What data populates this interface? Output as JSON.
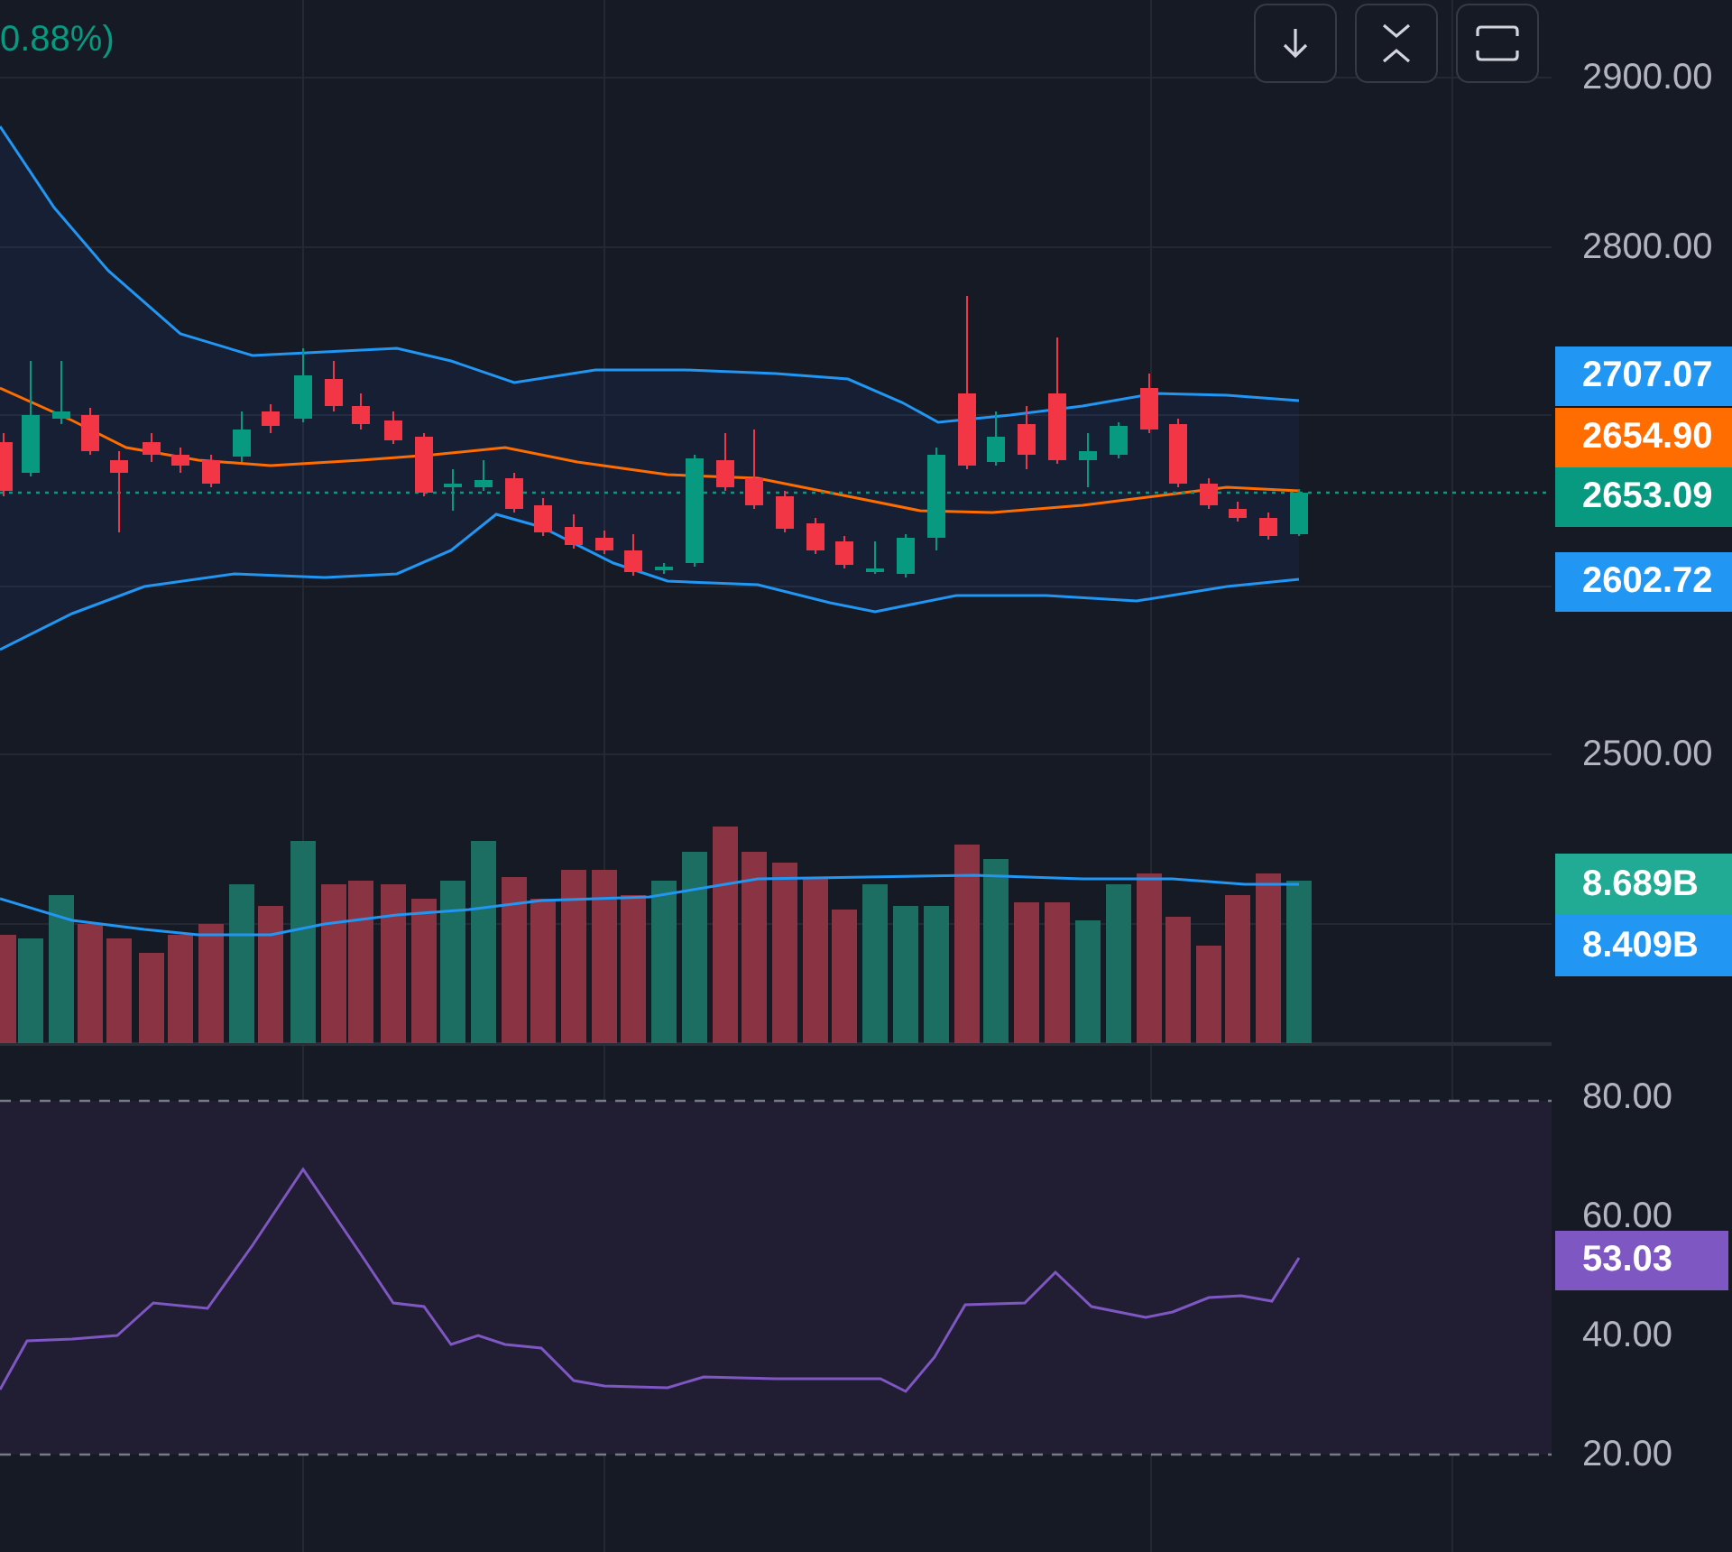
{
  "legend": {
    "change": "0.88%)"
  },
  "price_axis": {
    "ticks": [
      "2900.00",
      "2800.00",
      "2500.00"
    ]
  },
  "price_labels": [
    {
      "text": "2707.07",
      "color": "#2196f3"
    },
    {
      "text": "2654.90",
      "color": "#ff6d00"
    },
    {
      "text": "2653.09",
      "color": "#089981"
    },
    {
      "text": "2602.72",
      "color": "#2196f3"
    }
  ],
  "volume_labels": [
    {
      "text": "8.689B",
      "color": "#22ab94"
    },
    {
      "text": "8.409B",
      "color": "#2196f3"
    }
  ],
  "rsi_axis": {
    "ticks": [
      "80.00",
      "60.00",
      "40.00",
      "20.00"
    ]
  },
  "rsi_label": {
    "text": "53.03",
    "color": "#7e57c2"
  }
}
